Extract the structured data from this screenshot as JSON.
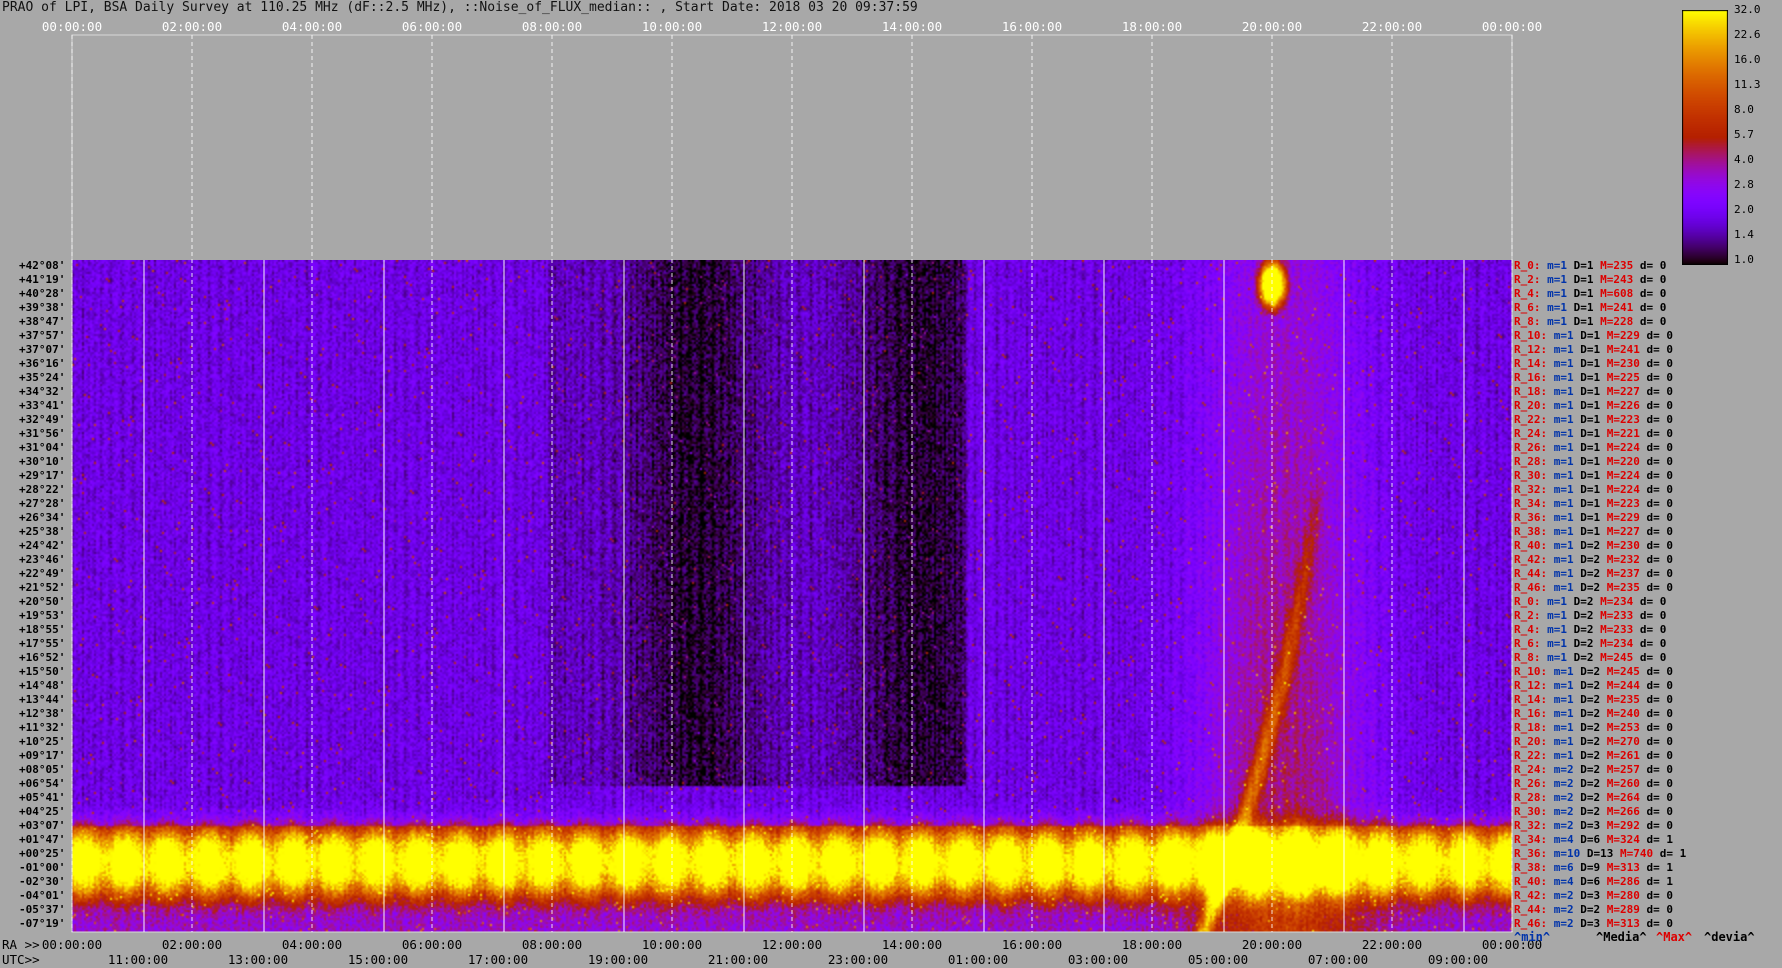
{
  "title": "PRAO of LPI, BSA Daily Survey at 110.25 MHz (dF::2.5 MHz), ::Noise_of_FLUX_median:: , Start Date: 2018 03 20 09:37:59",
  "axis_prefix_ra": "RA >>",
  "axis_prefix_utc": "UTC>>",
  "chart_data": {
    "type": "heatmap",
    "top_ticks": [
      "00:00:00",
      "02:00:00",
      "04:00:00",
      "06:00:00",
      "08:00:00",
      "10:00:00",
      "12:00:00",
      "14:00:00",
      "16:00:00",
      "18:00:00",
      "20:00:00",
      "22:00:00",
      "00:00:00"
    ],
    "ra_ticks": [
      "00:00:00",
      "02:00:00",
      "04:00:00",
      "06:00:00",
      "08:00:00",
      "10:00:00",
      "12:00:00",
      "14:00:00",
      "16:00:00",
      "18:00:00",
      "20:00:00",
      "22:00:00",
      "00:00:00"
    ],
    "utc_ticks": [
      "11:00:00",
      "13:00:00",
      "15:00:00",
      "17:00:00",
      "19:00:00",
      "21:00:00",
      "23:00:00",
      "01:00:00",
      "03:00:00",
      "05:00:00",
      "07:00:00",
      "09:00:00"
    ],
    "declinations": [
      "+42°08'",
      "+41°19'",
      "+40°28'",
      "+39°38'",
      "+38°47'",
      "+37°57'",
      "+37°07'",
      "+36°16'",
      "+35°24'",
      "+34°32'",
      "+33°41'",
      "+32°49'",
      "+31°56'",
      "+31°04'",
      "+30°10'",
      "+29°17'",
      "+28°22'",
      "+27°28'",
      "+26°34'",
      "+25°38'",
      "+24°42'",
      "+23°46'",
      "+22°49'",
      "+21°52'",
      "+20°50'",
      "+19°53'",
      "+18°55'",
      "+17°55'",
      "+16°52'",
      "+15°50'",
      "+14°48'",
      "+13°44'",
      "+12°38'",
      "+11°32'",
      "+10°25'",
      "+09°17'",
      "+08°05'",
      "+06°54'",
      "+05°41'",
      "+04°25'",
      "+03°07'",
      "+01°47'",
      "+00°25'",
      "-01°00'",
      "-02°30'",
      "-04°01'",
      "-05°37'",
      "-07°19'"
    ],
    "colorbar": {
      "ticks": [
        "32.0",
        "22.6",
        "16.0",
        "11.3",
        "8.0",
        "5.7",
        "4.0",
        "2.8",
        "2.0",
        "1.4",
        "1.0"
      ],
      "range": [
        1.0,
        32.0
      ],
      "scale": "log",
      "colormap": "gnuplot"
    },
    "stats_rows": [
      {
        "r": "R_0:",
        "m": "m=1",
        "D": "D=1",
        "M": "M=235",
        "d": "d= 0"
      },
      {
        "r": "R_2:",
        "m": "m=1",
        "D": "D=1",
        "M": "M=243",
        "d": "d= 0"
      },
      {
        "r": "R_4:",
        "m": "m=1",
        "D": "D=1",
        "M": "M=608",
        "d": "d= 0"
      },
      {
        "r": "R_6:",
        "m": "m=1",
        "D": "D=1",
        "M": "M=241",
        "d": "d= 0"
      },
      {
        "r": "R_8:",
        "m": "m=1",
        "D": "D=1",
        "M": "M=228",
        "d": "d= 0"
      },
      {
        "r": "R_10:",
        "m": "m=1",
        "D": "D=1",
        "M": "M=229",
        "d": "d= 0"
      },
      {
        "r": "R_12:",
        "m": "m=1",
        "D": "D=1",
        "M": "M=241",
        "d": "d= 0"
      },
      {
        "r": "R_14:",
        "m": "m=1",
        "D": "D=1",
        "M": "M=230",
        "d": "d= 0"
      },
      {
        "r": "R_16:",
        "m": "m=1",
        "D": "D=1",
        "M": "M=225",
        "d": "d= 0"
      },
      {
        "r": "R_18:",
        "m": "m=1",
        "D": "D=1",
        "M": "M=227",
        "d": "d= 0"
      },
      {
        "r": "R_20:",
        "m": "m=1",
        "D": "D=1",
        "M": "M=226",
        "d": "d= 0"
      },
      {
        "r": "R_22:",
        "m": "m=1",
        "D": "D=1",
        "M": "M=223",
        "d": "d= 0"
      },
      {
        "r": "R_24:",
        "m": "m=1",
        "D": "D=1",
        "M": "M=221",
        "d": "d= 0"
      },
      {
        "r": "R_26:",
        "m": "m=1",
        "D": "D=1",
        "M": "M=224",
        "d": "d= 0"
      },
      {
        "r": "R_28:",
        "m": "m=1",
        "D": "D=1",
        "M": "M=220",
        "d": "d= 0"
      },
      {
        "r": "R_30:",
        "m": "m=1",
        "D": "D=1",
        "M": "M=224",
        "d": "d= 0"
      },
      {
        "r": "R_32:",
        "m": "m=1",
        "D": "D=1",
        "M": "M=224",
        "d": "d= 0"
      },
      {
        "r": "R_34:",
        "m": "m=1",
        "D": "D=1",
        "M": "M=223",
        "d": "d= 0"
      },
      {
        "r": "R_36:",
        "m": "m=1",
        "D": "D=1",
        "M": "M=229",
        "d": "d= 0"
      },
      {
        "r": "R_38:",
        "m": "m=1",
        "D": "D=1",
        "M": "M=227",
        "d": "d= 0"
      },
      {
        "r": "R_40:",
        "m": "m=1",
        "D": "D=2",
        "M": "M=230",
        "d": "d= 0"
      },
      {
        "r": "R_42:",
        "m": "m=1",
        "D": "D=2",
        "M": "M=232",
        "d": "d= 0"
      },
      {
        "r": "R_44:",
        "m": "m=1",
        "D": "D=2",
        "M": "M=237",
        "d": "d= 0"
      },
      {
        "r": "R_46:",
        "m": "m=1",
        "D": "D=2",
        "M": "M=235",
        "d": "d= 0"
      },
      {
        "r": "R_0:",
        "m": "m=1",
        "D": "D=2",
        "M": "M=234",
        "d": "d= 0"
      },
      {
        "r": "R_2:",
        "m": "m=1",
        "D": "D=2",
        "M": "M=233",
        "d": "d= 0"
      },
      {
        "r": "R_4:",
        "m": "m=1",
        "D": "D=2",
        "M": "M=233",
        "d": "d= 0"
      },
      {
        "r": "R_6:",
        "m": "m=1",
        "D": "D=2",
        "M": "M=234",
        "d": "d= 0"
      },
      {
        "r": "R_8:",
        "m": "m=1",
        "D": "D=2",
        "M": "M=245",
        "d": "d= 0"
      },
      {
        "r": "R_10:",
        "m": "m=1",
        "D": "D=2",
        "M": "M=245",
        "d": "d= 0"
      },
      {
        "r": "R_12:",
        "m": "m=1",
        "D": "D=2",
        "M": "M=244",
        "d": "d= 0"
      },
      {
        "r": "R_14:",
        "m": "m=1",
        "D": "D=2",
        "M": "M=235",
        "d": "d= 0"
      },
      {
        "r": "R_16:",
        "m": "m=1",
        "D": "D=2",
        "M": "M=240",
        "d": "d= 0"
      },
      {
        "r": "R_18:",
        "m": "m=1",
        "D": "D=2",
        "M": "M=253",
        "d": "d= 0"
      },
      {
        "r": "R_20:",
        "m": "m=1",
        "D": "D=2",
        "M": "M=270",
        "d": "d= 0"
      },
      {
        "r": "R_22:",
        "m": "m=1",
        "D": "D=2",
        "M": "M=261",
        "d": "d= 0"
      },
      {
        "r": "R_24:",
        "m": "m=2",
        "D": "D=2",
        "M": "M=257",
        "d": "d= 0"
      },
      {
        "r": "R_26:",
        "m": "m=2",
        "D": "D=2",
        "M": "M=260",
        "d": "d= 0"
      },
      {
        "r": "R_28:",
        "m": "m=2",
        "D": "D=2",
        "M": "M=264",
        "d": "d= 0"
      },
      {
        "r": "R_30:",
        "m": "m=2",
        "D": "D=2",
        "M": "M=266",
        "d": "d= 0"
      },
      {
        "r": "R_32:",
        "m": "m=2",
        "D": "D=3",
        "M": "M=292",
        "d": "d= 0"
      },
      {
        "r": "R_34:",
        "m": "m=4",
        "D": "D=6",
        "M": "M=324",
        "d": "d= 1"
      },
      {
        "r": "R_36:",
        "m": "m=10",
        "D": "D=13",
        "M": "M=740",
        "d": "d= 1"
      },
      {
        "r": "R_38:",
        "m": "m=6",
        "D": "D=9",
        "M": "M=313",
        "d": "d= 1"
      },
      {
        "r": "R_40:",
        "m": "m=4",
        "D": "D=6",
        "M": "M=286",
        "d": "d= 1"
      },
      {
        "r": "R_42:",
        "m": "m=2",
        "D": "D=3",
        "M": "M=280",
        "d": "d= 0"
      },
      {
        "r": "R_44:",
        "m": "m=2",
        "D": "D=2",
        "M": "M=289",
        "d": "d= 0"
      },
      {
        "r": "R_46:",
        "m": "m=2",
        "D": "D=3",
        "M": "M=313",
        "d": "d= 0"
      }
    ],
    "legend": {
      "min": "^min^",
      "media": "^Media^",
      "max": "^Max^",
      "devia": "^devia^",
      "min_color": "#0033aa",
      "media_color": "#000000",
      "max_color": "#dd0000",
      "devia_color": "#000000"
    },
    "features": [
      {
        "name": "bright horizontal band",
        "dec_from": "+01°47'",
        "dec_to": "-04°01'"
      },
      {
        "name": "bright point source",
        "ra": "20:00:00",
        "dec": "+41°19'"
      },
      {
        "name": "diagonal emission streak",
        "ra_from": "19:00:00",
        "ra_to": "20:00:00"
      }
    ]
  }
}
